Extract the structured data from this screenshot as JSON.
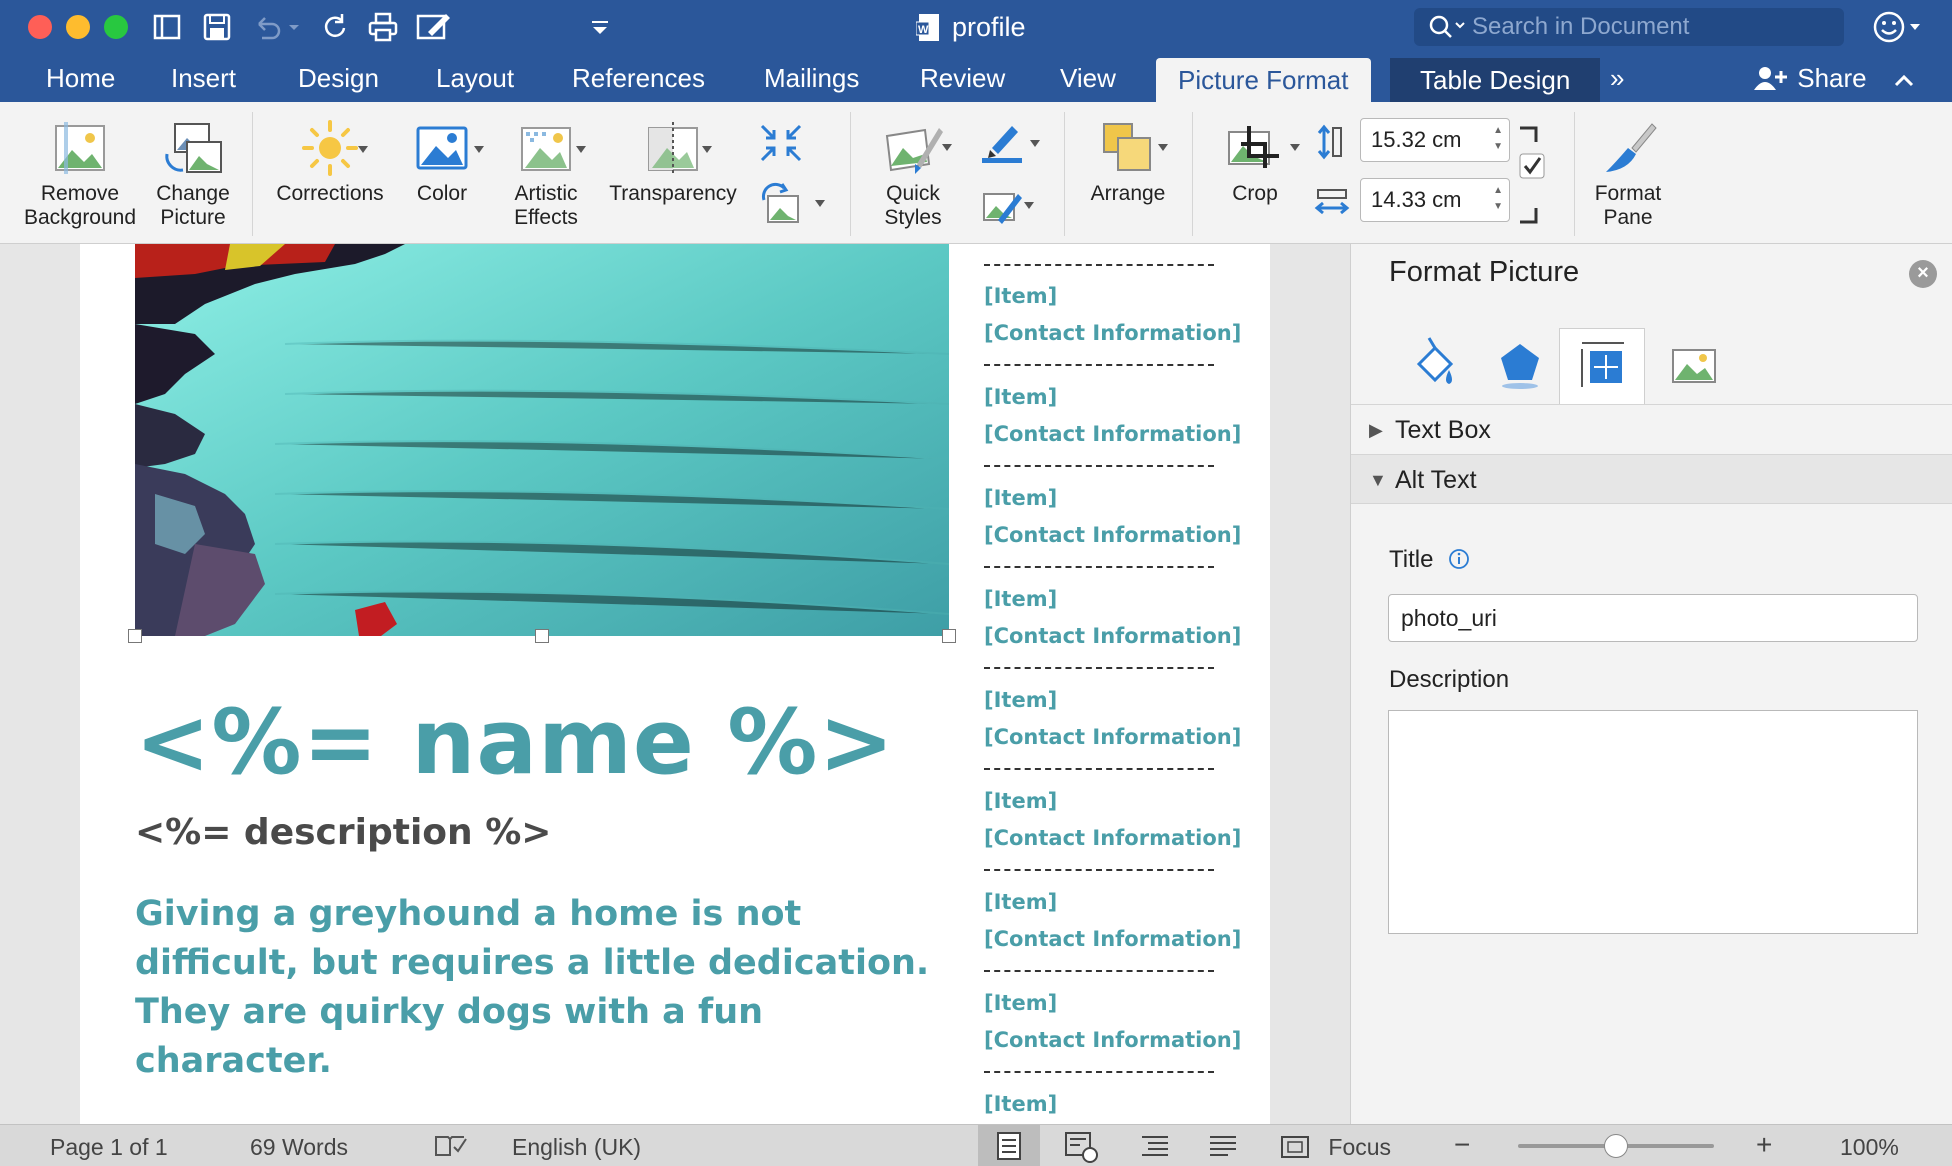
{
  "window": {
    "title": "profile",
    "search_placeholder": "Search in Document"
  },
  "tabs": [
    "Home",
    "Insert",
    "Design",
    "Layout",
    "References",
    "Mailings",
    "Review",
    "View",
    "Picture Format",
    "Table Design"
  ],
  "share_label": "Share",
  "ribbon": {
    "remove_bg": [
      "Remove",
      "Background"
    ],
    "change_picture": [
      "Change",
      "Picture"
    ],
    "corrections": "Corrections",
    "color": "Color",
    "artistic_effects": [
      "Artistic",
      "Effects"
    ],
    "transparency": "Transparency",
    "quick_styles": [
      "Quick",
      "Styles"
    ],
    "arrange": "Arrange",
    "crop": "Crop",
    "height": "15.32 cm",
    "width": "14.33 cm",
    "format_pane": [
      "Format",
      "Pane"
    ]
  },
  "document": {
    "name_placeholder": "<%= name %>",
    "description_placeholder": "<%= description %>",
    "body_text": "Giving a greyhound a home is not difficult, but requires a little dedication. They are quirky dogs with a fun character.",
    "item_label": "[Item]",
    "contact_label": "[Contact Information]"
  },
  "format_pane": {
    "title": "Format Picture",
    "sections": [
      "Text Box",
      "Alt Text"
    ],
    "title_label": "Title",
    "title_value": "photo_uri",
    "description_label": "Description",
    "description_value": ""
  },
  "status": {
    "page": "Page 1 of 1",
    "words": "69 Words",
    "language": "English (UK)",
    "focus": "Focus",
    "zoom": "100%"
  },
  "colors": {
    "brand": "#2b579a",
    "teal": "#4a9ea8"
  }
}
